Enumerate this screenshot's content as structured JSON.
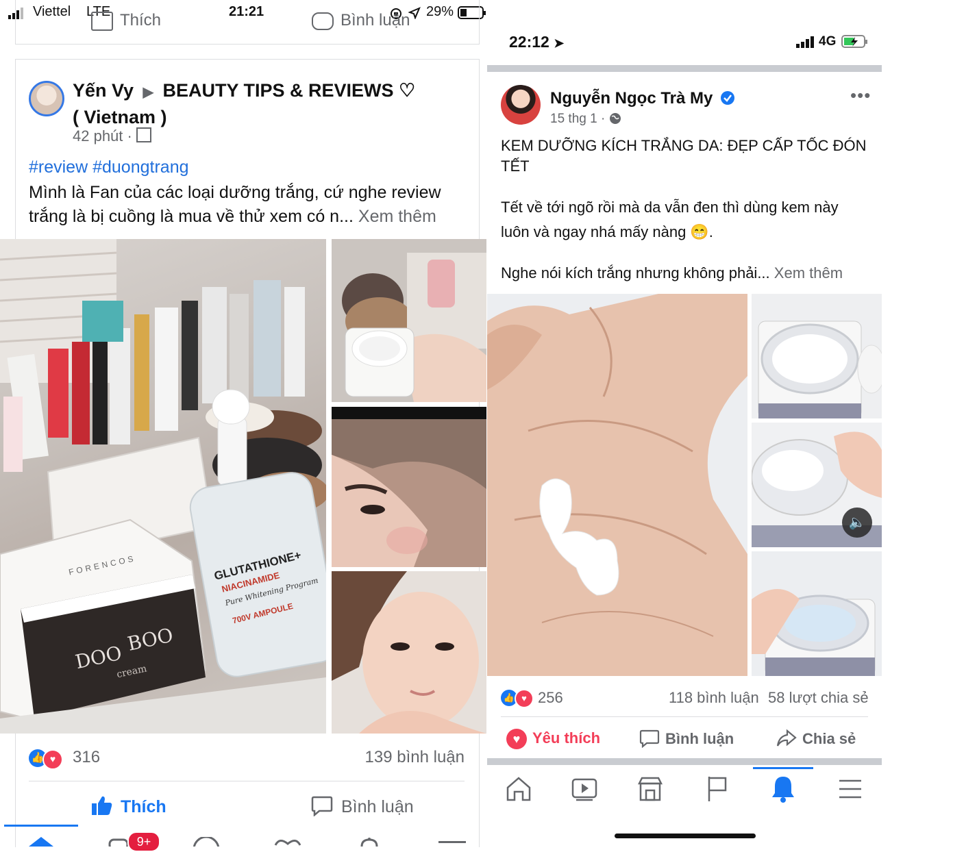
{
  "left": {
    "status": {
      "carrier": "Viettel",
      "network": "LTE",
      "time": "21:21",
      "battery": "29%"
    },
    "prev_actions": {
      "like": "Thích",
      "comment": "Bình luận"
    },
    "post": {
      "author": "Yến Vy",
      "group": "BEAUTY TIPS & REVIEWS ♡",
      "group_line2": "( Vietnam )",
      "time": "42 phút",
      "hashtags": "#review #duongtrang",
      "text": "Mình là Fan của các loại dưỡng trắng, cứ nghe review trắng là bị cuồng là mua về thử xem có n...",
      "see_more": "Xem thêm",
      "reactions_count": "316",
      "comments": "139 bình luận",
      "like_label": "Thích",
      "comment_label": "Bình luận",
      "notif_badge": "9+"
    },
    "product_text": {
      "glutathione": "GLUTATHIONE+",
      "niacinamide": "NIACINAMIDE",
      "script": "Pure Whitening Program",
      "ampoule": "700V AMPOULE",
      "brand": "FORENCOS",
      "doo": "DOO",
      "boo": "BOO",
      "cream": "cream"
    }
  },
  "right": {
    "status": {
      "time": "22:12",
      "network": "4G"
    },
    "post": {
      "author": "Nguyễn Ngọc Trà My",
      "time": "15 thg 1",
      "title": "KEM DƯỠNG KÍCH TRẮNG DA: ĐẸP CẤP TỐC ĐÓN TẾT",
      "para1_line1": "Tết về tới ngõ rồi mà da vẫn đen thì dùng kem này",
      "para1_line2": "luôn và ngay nhá mấy nàng 😁.",
      "para2": "Nghe nói kích trắng nhưng không phải...",
      "see_more": "Xem thêm",
      "reactions_count": "256",
      "comments": "118 bình luận",
      "shares": "58 lượt chia sẻ",
      "love_label": "Yêu thích",
      "comment_label": "Bình luận",
      "share_label": "Chia sẻ"
    },
    "tabs": [
      "home-icon",
      "watch-icon",
      "marketplace-icon",
      "pages-flag-icon",
      "notifications-bell-icon",
      "menu-icon"
    ]
  },
  "colors": {
    "fb_blue": "#1877f2",
    "love_red": "#f33e58",
    "text_gray": "#65676b",
    "hashtag": "#216fdb"
  }
}
